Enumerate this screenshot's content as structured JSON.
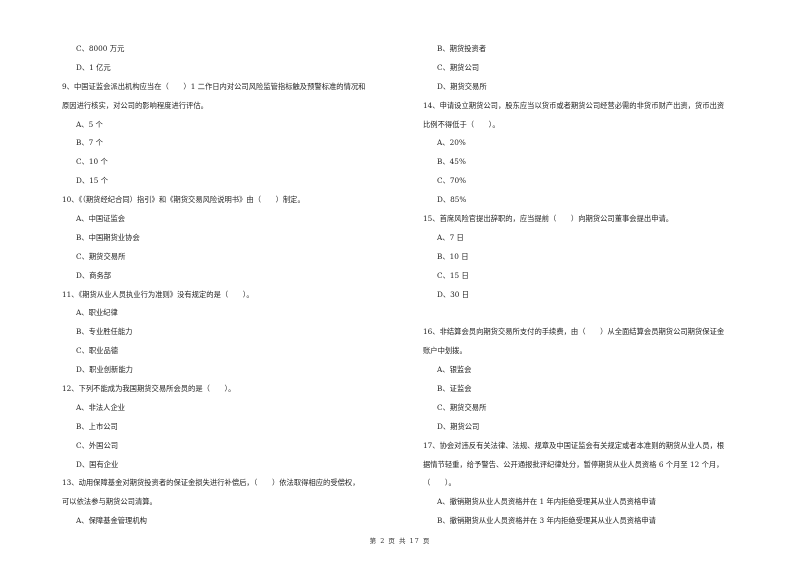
{
  "left_column": [
    {
      "kind": "opt",
      "text": "C、8000 万元"
    },
    {
      "kind": "opt",
      "text": "D、1 亿元"
    },
    {
      "kind": "q",
      "text": "9、中国证监会派出机构应当在（　　）1 二作日内对公司风险监管指标触及预警标准的情况和"
    },
    {
      "kind": "q",
      "text": "原因进行核实，对公司的影响程度进行评估。"
    },
    {
      "kind": "opt",
      "text": "A、5 个"
    },
    {
      "kind": "opt",
      "text": "B、7 个"
    },
    {
      "kind": "opt",
      "text": "C、10 个"
    },
    {
      "kind": "opt",
      "text": "D、15 个"
    },
    {
      "kind": "q",
      "text": "10、《（期货经纪合同）指引》和《期货交易风险说明书》由（　　）制定。"
    },
    {
      "kind": "opt",
      "text": "A、中国证监会"
    },
    {
      "kind": "opt",
      "text": "B、中国期货业协会"
    },
    {
      "kind": "opt",
      "text": "C、期货交易所"
    },
    {
      "kind": "opt",
      "text": "D、商务部"
    },
    {
      "kind": "q",
      "text": "11、《期货从业人员执业行为准则》没有规定的是（　　）。"
    },
    {
      "kind": "opt",
      "text": "A、职业纪律"
    },
    {
      "kind": "opt",
      "text": "B、专业胜任能力"
    },
    {
      "kind": "opt",
      "text": "C、职业品德"
    },
    {
      "kind": "opt",
      "text": "D、职业创新能力"
    },
    {
      "kind": "q",
      "text": "12、下列不能成为我国期货交易所会员的是（　　）。"
    },
    {
      "kind": "opt",
      "text": "A、非法人企业"
    },
    {
      "kind": "opt",
      "text": "B、上市公司"
    },
    {
      "kind": "opt",
      "text": "C、外国公司"
    },
    {
      "kind": "opt",
      "text": "D、国有企业"
    },
    {
      "kind": "q",
      "text": "13、动用保障基金对期货投资者的保证金损失进行补偿后，（　　）依法取得相应的受偿权，"
    },
    {
      "kind": "q",
      "text": "可以依法参与期货公司清算。"
    },
    {
      "kind": "opt",
      "text": "A、保障基金管理机构"
    }
  ],
  "right_column": [
    {
      "kind": "opt",
      "text": "B、期货投资者"
    },
    {
      "kind": "opt",
      "text": "C、期货公司"
    },
    {
      "kind": "opt",
      "text": "D、期货交易所"
    },
    {
      "kind": "q",
      "text": "14、申请设立期货公司，股东应当以货币或者期货公司经营必需的非货币财产出资，货币出资"
    },
    {
      "kind": "q",
      "text": "比例不得低于（　　）。"
    },
    {
      "kind": "opt",
      "text": "A、20%"
    },
    {
      "kind": "opt",
      "text": "B、45%"
    },
    {
      "kind": "opt",
      "text": "C、70%"
    },
    {
      "kind": "opt",
      "text": "D、85%"
    },
    {
      "kind": "q",
      "text": "15、首席风险官提出辞职的，应当提前（　　）向期货公司董事会提出申请。"
    },
    {
      "kind": "opt",
      "text": "A、7 日"
    },
    {
      "kind": "opt",
      "text": "B、10 日"
    },
    {
      "kind": "opt",
      "text": "C、15 日"
    },
    {
      "kind": "opt",
      "text": "D、30 日"
    },
    {
      "kind": "blank",
      "text": ""
    },
    {
      "kind": "q",
      "text": "16、非结算会员向期货交易所支付的手续费，由（　　）从全面结算会员期货公司期货保证金"
    },
    {
      "kind": "q",
      "text": "账户中划拨。"
    },
    {
      "kind": "opt",
      "text": "A、银监会"
    },
    {
      "kind": "opt",
      "text": "B、证监会"
    },
    {
      "kind": "opt",
      "text": "C、期货交易所"
    },
    {
      "kind": "opt",
      "text": "D、期货公司"
    },
    {
      "kind": "q",
      "text": "17、协会对违反有关法律、法规、规章及中国证监会有关规定或者本准则的期货从业人员，根"
    },
    {
      "kind": "q",
      "text": "据情节轻重，给予警告、公开通报批评纪律处分，暂停期货从业人员资格 6 个月至 12 个月，"
    },
    {
      "kind": "q",
      "text": "（　　）。"
    },
    {
      "kind": "opt",
      "text": "A、撤销期货从业人员资格并在 1 年内拒绝受理其从业人员资格申请"
    },
    {
      "kind": "opt",
      "text": "B、撤销期货从业人员资格并在 3 年内拒绝受理其从业人员资格申请"
    }
  ],
  "footer": {
    "page_label": "第 2 页 共 17 页"
  }
}
